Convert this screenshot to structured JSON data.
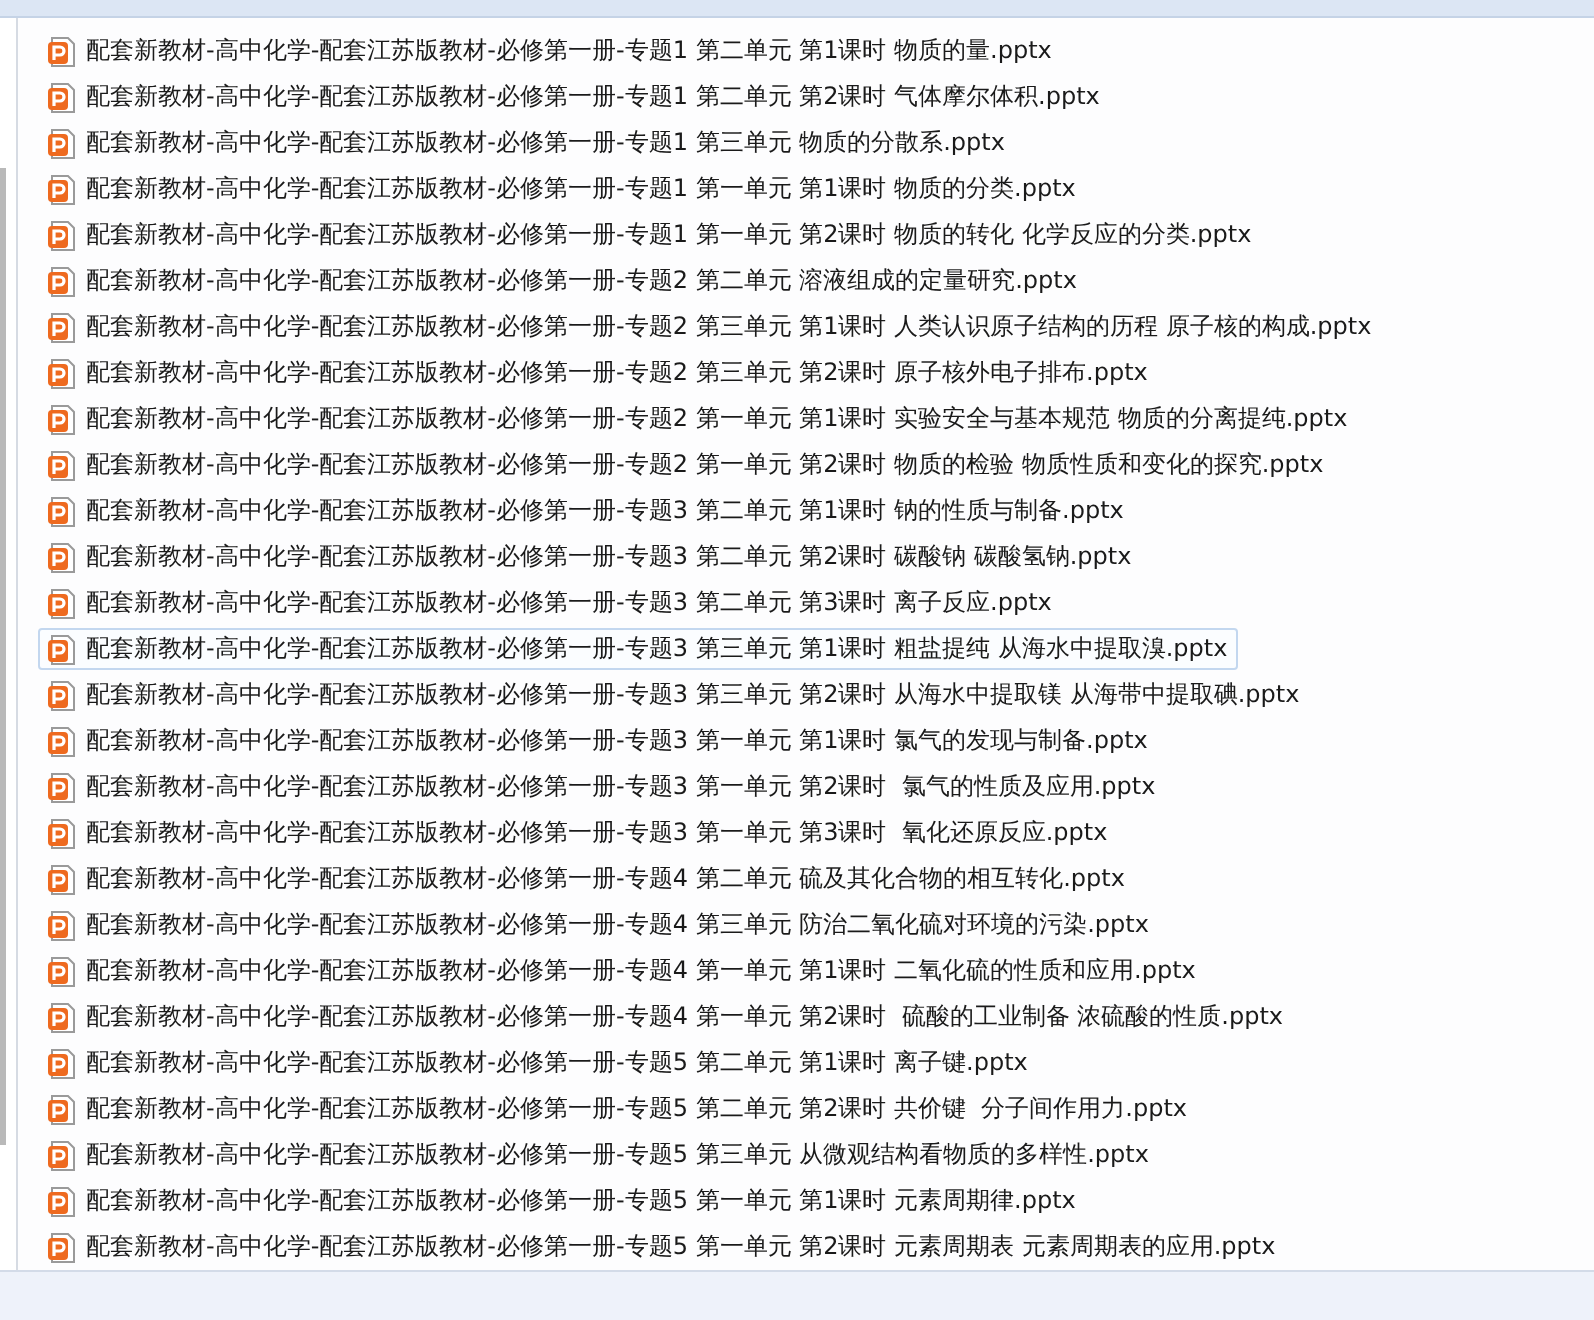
{
  "files": [
    {
      "name": "配套新教材-高中化学-配套江苏版教材-必修第一册-专题1 第二单元 第1课时 物质的量.pptx",
      "selected": false
    },
    {
      "name": "配套新教材-高中化学-配套江苏版教材-必修第一册-专题1 第二单元 第2课时 气体摩尔体积.pptx",
      "selected": false
    },
    {
      "name": "配套新教材-高中化学-配套江苏版教材-必修第一册-专题1 第三单元 物质的分散系.pptx",
      "selected": false
    },
    {
      "name": "配套新教材-高中化学-配套江苏版教材-必修第一册-专题1 第一单元 第1课时 物质的分类.pptx",
      "selected": false
    },
    {
      "name": "配套新教材-高中化学-配套江苏版教材-必修第一册-专题1 第一单元 第2课时 物质的转化 化学反应的分类.pptx",
      "selected": false
    },
    {
      "name": "配套新教材-高中化学-配套江苏版教材-必修第一册-专题2 第二单元 溶液组成的定量研究.pptx",
      "selected": false
    },
    {
      "name": "配套新教材-高中化学-配套江苏版教材-必修第一册-专题2 第三单元 第1课时 人类认识原子结构的历程 原子核的构成.pptx",
      "selected": false
    },
    {
      "name": "配套新教材-高中化学-配套江苏版教材-必修第一册-专题2 第三单元 第2课时 原子核外电子排布.pptx",
      "selected": false
    },
    {
      "name": "配套新教材-高中化学-配套江苏版教材-必修第一册-专题2 第一单元 第1课时 实验安全与基本规范 物质的分离提纯.pptx",
      "selected": false
    },
    {
      "name": "配套新教材-高中化学-配套江苏版教材-必修第一册-专题2 第一单元 第2课时 物质的检验 物质性质和变化的探究.pptx",
      "selected": false
    },
    {
      "name": "配套新教材-高中化学-配套江苏版教材-必修第一册-专题3 第二单元 第1课时 钠的性质与制备.pptx",
      "selected": false
    },
    {
      "name": "配套新教材-高中化学-配套江苏版教材-必修第一册-专题3 第二单元 第2课时 碳酸钠 碳酸氢钠.pptx",
      "selected": false
    },
    {
      "name": "配套新教材-高中化学-配套江苏版教材-必修第一册-专题3 第二单元 第3课时 离子反应.pptx",
      "selected": false
    },
    {
      "name": "配套新教材-高中化学-配套江苏版教材-必修第一册-专题3 第三单元 第1课时 粗盐提纯 从海水中提取溴.pptx",
      "selected": true
    },
    {
      "name": "配套新教材-高中化学-配套江苏版教材-必修第一册-专题3 第三单元 第2课时 从海水中提取镁 从海带中提取碘.pptx",
      "selected": false
    },
    {
      "name": "配套新教材-高中化学-配套江苏版教材-必修第一册-专题3 第一单元 第1课时 氯气的发现与制备.pptx",
      "selected": false
    },
    {
      "name": "配套新教材-高中化学-配套江苏版教材-必修第一册-专题3 第一单元 第2课时  氯气的性质及应用.pptx",
      "selected": false
    },
    {
      "name": "配套新教材-高中化学-配套江苏版教材-必修第一册-专题3 第一单元 第3课时  氧化还原反应.pptx",
      "selected": false
    },
    {
      "name": "配套新教材-高中化学-配套江苏版教材-必修第一册-专题4 第二单元 硫及其化合物的相互转化.pptx",
      "selected": false
    },
    {
      "name": "配套新教材-高中化学-配套江苏版教材-必修第一册-专题4 第三单元 防治二氧化硫对环境的污染.pptx",
      "selected": false
    },
    {
      "name": "配套新教材-高中化学-配套江苏版教材-必修第一册-专题4 第一单元 第1课时 二氧化硫的性质和应用.pptx",
      "selected": false
    },
    {
      "name": "配套新教材-高中化学-配套江苏版教材-必修第一册-专题4 第一单元 第2课时  硫酸的工业制备 浓硫酸的性质.pptx",
      "selected": false
    },
    {
      "name": "配套新教材-高中化学-配套江苏版教材-必修第一册-专题5 第二单元 第1课时 离子键.pptx",
      "selected": false
    },
    {
      "name": "配套新教材-高中化学-配套江苏版教材-必修第一册-专题5 第二单元 第2课时 共价键  分子间作用力.pptx",
      "selected": false
    },
    {
      "name": "配套新教材-高中化学-配套江苏版教材-必修第一册-专题5 第三单元 从微观结构看物质的多样性.pptx",
      "selected": false
    },
    {
      "name": "配套新教材-高中化学-配套江苏版教材-必修第一册-专题5 第一单元 第1课时 元素周期律.pptx",
      "selected": false
    },
    {
      "name": "配套新教材-高中化学-配套江苏版教材-必修第一册-专题5 第一单元 第2课时 元素周期表 元素周期表的应用.pptx",
      "selected": false
    }
  ]
}
